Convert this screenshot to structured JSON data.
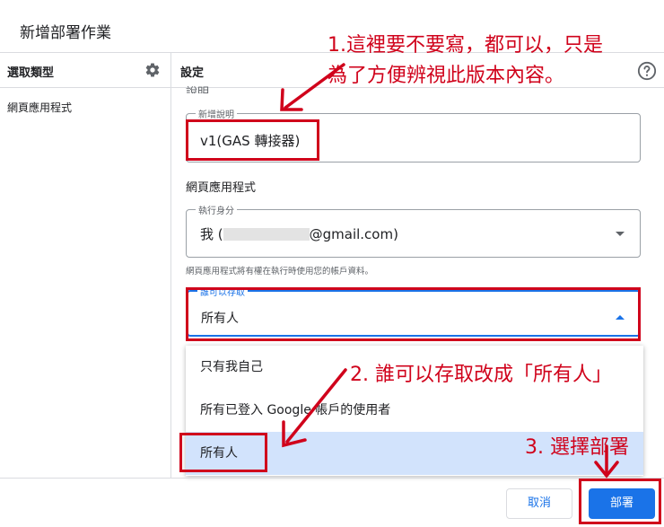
{
  "dialog": {
    "title": "新增部署作業"
  },
  "left_panel": {
    "header": "選取類型",
    "items": [
      "網頁應用程式"
    ]
  },
  "right_panel": {
    "header": "設定",
    "description_section_label": "說明",
    "description": {
      "legend": "新增說明",
      "value": "v1(GAS 轉接器)"
    },
    "webapp_label": "網頁應用程式",
    "execute_as": {
      "legend": "執行身分",
      "value": "我 (",
      "email_suffix": "@gmail.com)"
    },
    "hint": "網頁應用程式將有權在執行時使用您的帳戶資料。",
    "access": {
      "legend": "誰可以存取",
      "value": "所有人",
      "options": [
        "只有我自己",
        "所有已登入 Google 帳戶的使用者",
        "所有人"
      ]
    }
  },
  "footer": {
    "cancel": "取消",
    "deploy": "部署"
  },
  "annotations": {
    "note1_line1": "1.這裡要不要寫，都可以，只是",
    "note1_line2": "為了方便辨視此版本內容。",
    "note2": "2. 誰可以存取改成「所有人」",
    "note3": "3. 選擇部署"
  },
  "colors": {
    "accent": "#1a73e8",
    "annotation": "#d0021b",
    "selected_option": "#d2e3fc"
  }
}
